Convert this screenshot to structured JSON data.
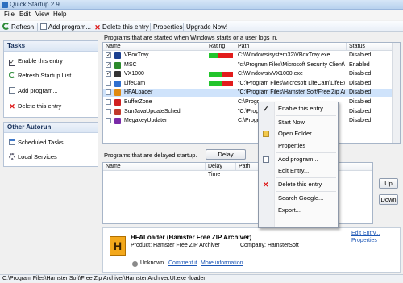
{
  "window": {
    "title": "Quick Startup 2.9"
  },
  "menu": [
    "File",
    "Edit",
    "View",
    "Help"
  ],
  "toolbar": {
    "refresh": "Refresh",
    "add": "Add program...",
    "delete": "Delete this entry",
    "properties": "Properties",
    "upgrade": "Upgrade Now!"
  },
  "tasks": {
    "title": "Tasks",
    "items": [
      "Enable this entry",
      "Refresh Startup List",
      "Add program...",
      "Delete this entry"
    ]
  },
  "other": {
    "title": "Other Autorun",
    "items": [
      "Scheduled Tasks",
      "Local Services"
    ]
  },
  "top_table": {
    "caption": "Programs that are started when Windows starts or a user logs in.",
    "headers": [
      "Name",
      "Rating",
      "Path",
      "Status"
    ],
    "rows": [
      {
        "name": "VBoxTray",
        "checked": true,
        "rating": 0.4,
        "path": "C:\\Windows\\system32\\VBoxTray.exe",
        "status": "Disabled",
        "color": "#1a3f8f"
      },
      {
        "name": "MSC",
        "checked": true,
        "rating": 0.0,
        "path": "\"c:\\Program Files\\Microsoft Security Client\\m",
        "status": "Enabled",
        "color": "#2c8a2c"
      },
      {
        "name": "VX1000",
        "checked": true,
        "rating": 0.55,
        "path": "C:\\Windows\\vVX1000.exe",
        "status": "Disabled",
        "color": "#333333"
      },
      {
        "name": "LifeCam",
        "checked": false,
        "rating": 0.55,
        "path": "\"C:\\Program Files\\Microsoft LifeCam\\LifeExp",
        "status": "Disabled",
        "color": "#2f6fcf"
      },
      {
        "name": "HFALoader",
        "checked": false,
        "rating": 0.0,
        "path": "\"C:\\Program Files\\Hamster Soft\\Free Zip Ard",
        "status": "Disabled",
        "color": "#e08a10",
        "selected": true
      },
      {
        "name": "BufferZone",
        "checked": false,
        "rating": 0.0,
        "path": "C:\\Progr",
        "status": "Disabled",
        "color": "#d02020"
      },
      {
        "name": "SunJavaUpdateSched",
        "checked": false,
        "rating": 0.0,
        "path": "\"C:\\Progr",
        "status": "Disabled",
        "color": "#c0392b"
      },
      {
        "name": "MegakeyUpdater",
        "checked": false,
        "rating": 0.0,
        "path": "C:\\Progr",
        "status": "Disabled",
        "color": "#7a2aa8"
      }
    ]
  },
  "delayed": {
    "caption": "Programs that are delayed startup.",
    "delay_btn": "Delay",
    "headers": [
      "Name",
      "Delay Time",
      "Path"
    ],
    "up_btn": "Up",
    "down_btn": "Down"
  },
  "details": {
    "title": "HFALoader (Hamster Free ZIP Archiver)",
    "product_label": "Product:",
    "product": "Hamster Free ZIP Archiver",
    "company_label": "Company:",
    "company": "HamsterSoft",
    "rating_text": "Unknown",
    "comment_link": "Comment it",
    "more_link": "More information",
    "edit_link": "Edit Entry...",
    "properties_link": "Properties"
  },
  "status_path": "C:\\Program Files\\Hamster Soft\\Free Zip Archiver\\Hamster.Archiver.UI.exe -loader",
  "context_menu": [
    {
      "label": "Enable this entry",
      "icon": "check-icon"
    },
    {
      "sep": true
    },
    {
      "label": "Start Now",
      "icon": ""
    },
    {
      "label": "Open Folder",
      "icon": "folder-icon"
    },
    {
      "label": "Properties",
      "icon": ""
    },
    {
      "sep": true
    },
    {
      "label": "Add program...",
      "icon": "document-icon"
    },
    {
      "label": "Edit Entry...",
      "icon": ""
    },
    {
      "sep": true
    },
    {
      "label": "Delete this entry",
      "icon": "delete-icon"
    },
    {
      "sep": true
    },
    {
      "label": "Search Google...",
      "icon": ""
    },
    {
      "label": "Export...",
      "icon": ""
    }
  ],
  "colors": {
    "accent": "#2d6fbf",
    "selection": "#cfe3fb",
    "rating_green": "#22c42c",
    "rating_red": "#e21c1c",
    "link": "#1a55b5"
  }
}
